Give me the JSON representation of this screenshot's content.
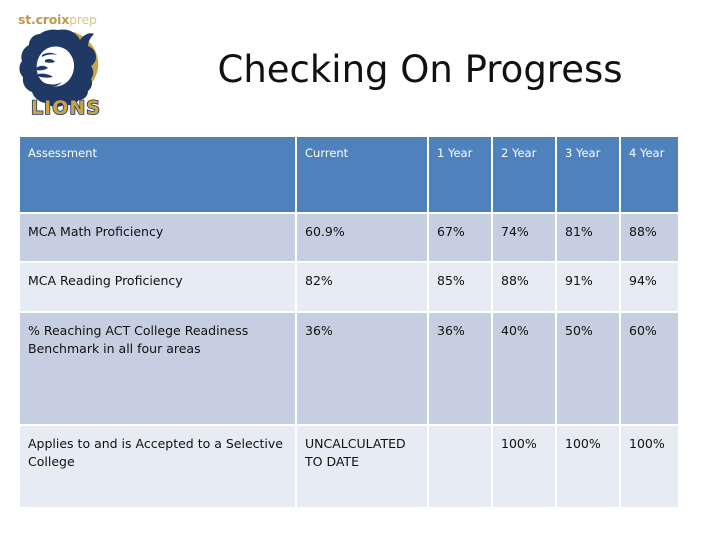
{
  "slide": {
    "title": "Checking On Progress",
    "background_color": "#ffffff"
  },
  "logo": {
    "wordmark_bold": "st.croix",
    "wordmark_light": "prep",
    "mascot_text": "LIONS",
    "navy_color": "#1f3864",
    "gold_color": "#c9a444"
  },
  "table": {
    "header_background": "#4f81bd",
    "header_text_color": "#ffffff",
    "row_band_dark": "#c6cfe1",
    "row_band_light": "#e7ebf3",
    "columns": [
      "Assessment",
      "Current",
      "1 Year",
      "2 Year",
      "4 Year"
    ],
    "headers": {
      "assessment": "Assessment",
      "current": "Current",
      "y1": "1 Year",
      "y2": "2 Year",
      "y3": "3 Year",
      "y4": "4 Year"
    },
    "rows": [
      {
        "assessment": "MCA  Math Proficiency",
        "current": "60.9%",
        "y1": "67%",
        "y2": "74%",
        "y3": "81%",
        "y4": "88%"
      },
      {
        "assessment": "MCA Reading Proficiency",
        "current": "82%",
        "y1": "85%",
        "y2": "88%",
        "y3": "91%",
        "y4": "94%"
      },
      {
        "assessment": "% Reaching ACT College Readiness Benchmark in all four areas",
        "current": "36%",
        "y1": "36%",
        "y2": "40%",
        "y3": "50%",
        "y4": "60%"
      },
      {
        "assessment": "Applies to and is Accepted to a Selective College",
        "current": "UNCALCULATED TO DATE",
        "y1": "",
        "y2": "100%",
        "y3": "100%",
        "y4": "100%"
      }
    ]
  }
}
